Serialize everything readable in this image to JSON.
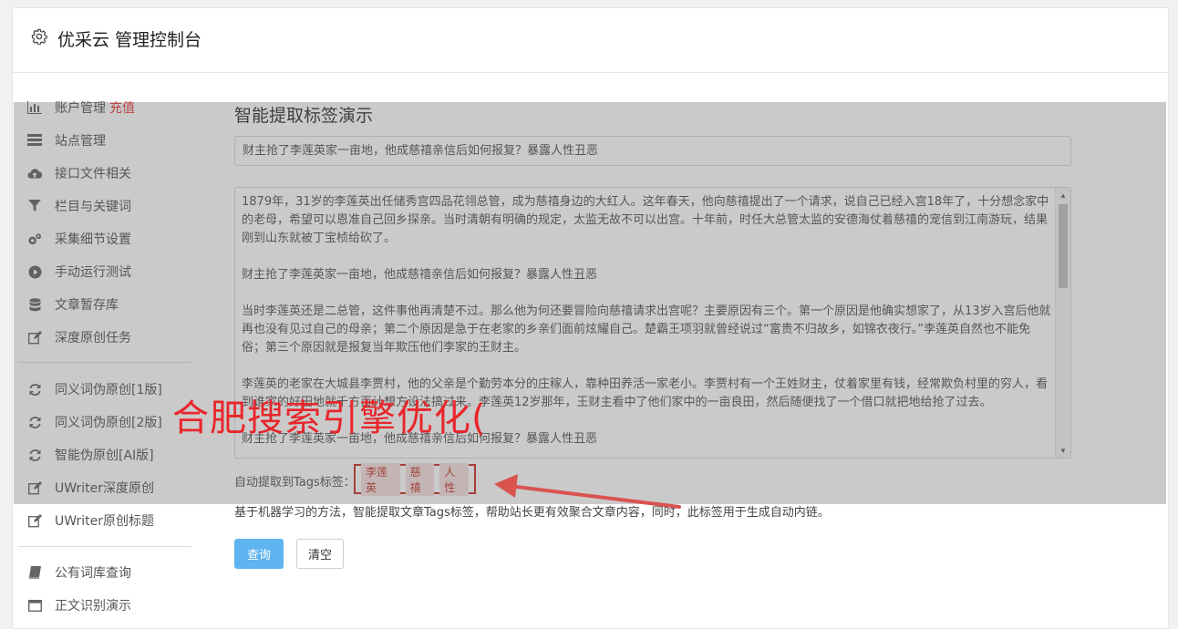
{
  "header": {
    "title": "优采云 管理控制台",
    "icon": "gear-icon"
  },
  "sidebar": {
    "items": [
      {
        "label": "账户管理",
        "badge": "充值",
        "icon": "bar-chart-icon"
      },
      {
        "label": "站点管理",
        "icon": "server-icon"
      },
      {
        "label": "接口文件相关",
        "icon": "cloud-upload-icon"
      },
      {
        "label": "栏目与关键词",
        "icon": "filter-icon"
      },
      {
        "label": "采集细节设置",
        "icon": "cogs-icon"
      },
      {
        "label": "手动运行测试",
        "icon": "play-circle-icon"
      },
      {
        "label": "文章暂存库",
        "icon": "database-icon"
      },
      {
        "label": "深度原创任务",
        "icon": "edit-icon"
      },
      {
        "label": "同义词伪原创[1版]",
        "icon": "refresh-icon"
      },
      {
        "label": "同义词伪原创[2版]",
        "icon": "refresh-icon"
      },
      {
        "label": "智能伪原创[AI版]",
        "icon": "refresh-icon"
      },
      {
        "label": "UWriter深度原创",
        "icon": "edit-icon"
      },
      {
        "label": "UWriter原创标题",
        "icon": "edit-icon"
      },
      {
        "label": "公有词库查询",
        "icon": "book-icon"
      },
      {
        "label": "正文识别演示",
        "icon": "window-icon"
      }
    ]
  },
  "main": {
    "title": "智能提取标签演示",
    "title_input_value": "财主抢了李莲英家一亩地，他成慈禧亲信后如何报复？暴露人性丑恶",
    "content_paragraphs": [
      "1879年，31岁的李莲英出任储秀宫四品花翎总管，成为慈禧身边的大红人。这年春天，他向慈禧提出了一个请求，说自己已经入宫18年了，十分想念家中的老母，希望可以恩准自己回乡探亲。当时清朝有明确的规定，太监无故不可以出宫。十年前，时任大总管太监的安德海仗着慈禧的宠信到江南游玩，结果刚到山东就被丁宝桢给砍了。",
      "财主抢了李莲英家一亩地，他成慈禧亲信后如何报复？暴露人性丑恶",
      "当时李莲英还是二总管，这件事他再清楚不过。那么他为何还要冒险向慈禧请求出宫呢？主要原因有三个。第一个原因是他确实想家了，从13岁入宫后他就再也没有见过自己的母亲；第二个原因是急于在老家的乡亲们面前炫耀自己。楚霸王项羽就曾经说过“富贵不归故乡，如锦衣夜行。”李莲英自然也不能免俗；第三个原因就是报复当年欺压他们李家的王财主。",
      "李莲英的老家在大城县李贾村，他的父亲是个勤劳本分的庄稼人，靠种田养活一家老小。李贾村有一个王姓财主，仗着家里有钱，经常欺负村里的穷人，看到谁家的好田地就千方百计想方设法搞过来。李莲英12岁那年，王财主看中了他们家中的一亩良田，然后随便找了一个借口就把地给抢了过去。",
      "财主抢了李莲英家一亩地，他成慈禧亲信后如何报复？暴露人性丑恶"
    ],
    "tags_label": "自动提取到Tags标签：",
    "tags": [
      "李莲英",
      "慈禧",
      "人性"
    ],
    "description": "基于机器学习的方法，智能提取文章Tags标签，帮助站长更有效聚合文章内容，同时，此标签用于生成自动内链。",
    "query_button": "查询",
    "clear_button": "清空"
  },
  "watermark": "合肥搜索引擎优化(",
  "colors": {
    "accent": "#5fb3ef",
    "annotation": "#c9302c"
  }
}
